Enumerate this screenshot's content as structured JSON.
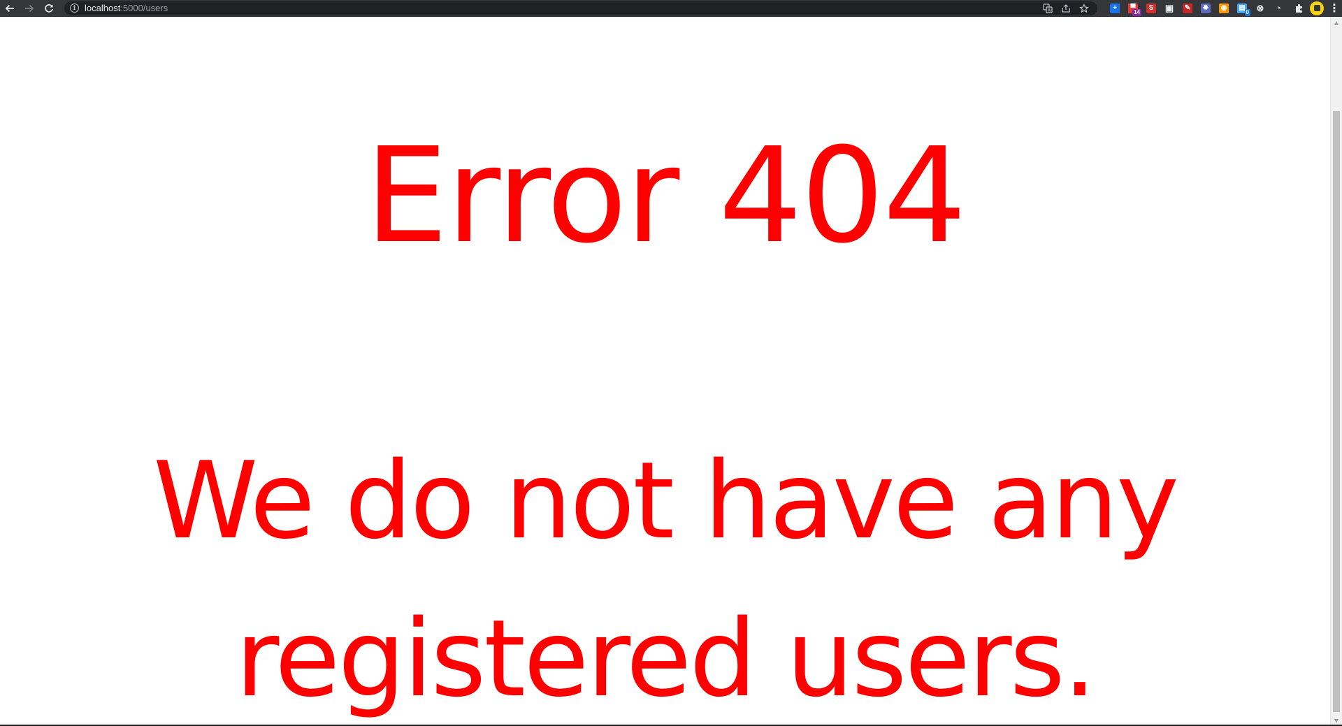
{
  "browser": {
    "url_host": "localhost",
    "url_path": ":5000/users",
    "nav": {
      "back_icon": "arrow-left-icon",
      "forward_icon": "arrow-right-icon",
      "reload_icon": "reload-icon"
    },
    "omnibox_icons": [
      "translate-icon",
      "share-icon",
      "bookmark-star-icon"
    ],
    "extensions": [
      {
        "name": "extension-plus",
        "color": "#1a73e8",
        "glyph": "+",
        "badge": ""
      },
      {
        "name": "extension-chat",
        "color": "#e53935",
        "glyph": "▀",
        "badge": "14",
        "badge_color": "#8e24aa"
      },
      {
        "name": "extension-s",
        "color": "#d32f2f",
        "glyph": "S",
        "badge": ""
      },
      {
        "name": "extension-window",
        "color": "#e8eaed",
        "glyph": "▣",
        "badge": ""
      },
      {
        "name": "extension-pen",
        "color": "#c62828",
        "glyph": "✎",
        "badge": ""
      },
      {
        "name": "extension-gear",
        "color": "#5c6bc0",
        "glyph": "✹",
        "badge": ""
      },
      {
        "name": "extension-owl",
        "color": "#ff9800",
        "glyph": "◉",
        "badge": ""
      },
      {
        "name": "extension-docs",
        "color": "#42a5f5",
        "glyph": "▤",
        "badge": "0",
        "badge_color": "#1976d2"
      },
      {
        "name": "extension-circle",
        "color": "#e8eaed",
        "glyph": "⊗",
        "badge": ""
      },
      {
        "name": "extension-timer",
        "color": "#e8eaed",
        "glyph": "◔",
        "badge": ""
      }
    ],
    "puzzle_icon": "puzzle-icon",
    "menu_glyph": "⋮"
  },
  "page": {
    "headline": "Error 404",
    "message_line_1": "We do not have any",
    "message_line_2": "registered users.",
    "text_color": "#ff0000"
  }
}
